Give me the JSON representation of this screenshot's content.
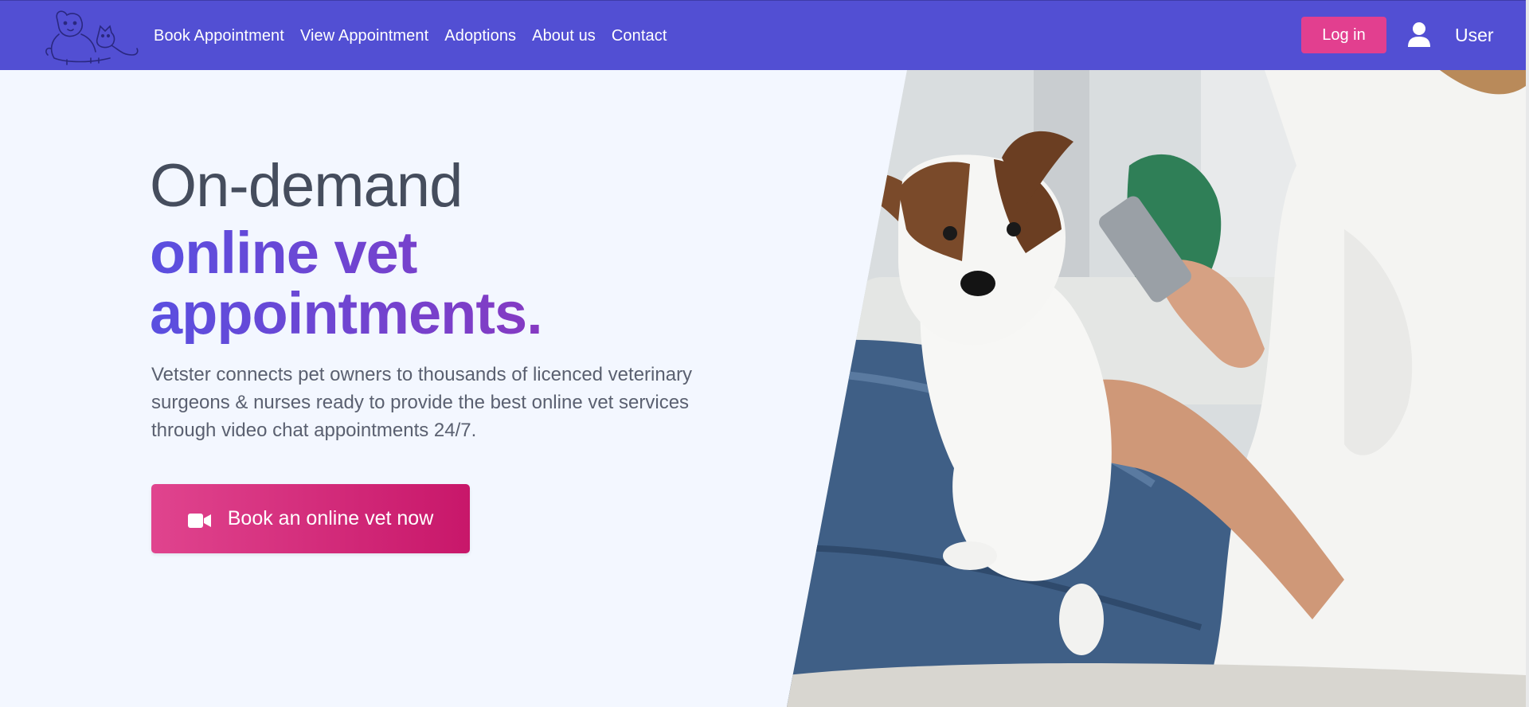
{
  "nav": {
    "links": [
      "Book Appointment",
      "View Appointment",
      "Adoptions",
      "About us",
      "Contact"
    ],
    "login_label": "Log in",
    "user_label": "User"
  },
  "hero": {
    "title_line1": "On-demand",
    "title_line2": "online vet appointments.",
    "description": "Vetster connects pet owners to thousands of licenced veterinary surgeons & nurses ready to provide the best online vet services through video chat appointments 24/7.",
    "cta_label": "Book an online vet now",
    "cta_icon": "video-camera-icon",
    "image_subject": "dog-with-woman-using-phone"
  },
  "colors": {
    "nav_bg": "#524fd3",
    "login_bg": "#e23f8f",
    "cta_gradient": [
      "#e0448e",
      "#c8176a"
    ],
    "title_gradient": [
      "#5a4fe0",
      "#9a2fb3"
    ],
    "page_bg": "#f3f7ff"
  }
}
